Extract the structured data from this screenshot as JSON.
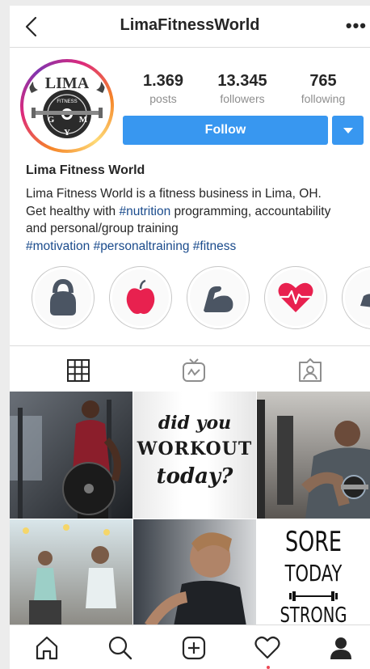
{
  "header": {
    "title": "LimaFitnessWorld",
    "more_label": "•••",
    "back_icon": "chevron-left-icon"
  },
  "profile": {
    "avatar_logo": {
      "top": "LIMA",
      "ring": "FITNESS",
      "g": "G",
      "m": "M",
      "y": "Y"
    },
    "stats": [
      {
        "value": "1.369",
        "label": "posts"
      },
      {
        "value": "13.345",
        "label": "followers"
      },
      {
        "value": "765",
        "label": "following"
      }
    ],
    "follow_label": "Follow",
    "accent": "#3897f0",
    "name": "Lima Fitness World",
    "bio": {
      "line1": "Lima Fitness World is a fitness business in Lima, OH.",
      "line2_a": "Get healthy with ",
      "line2_tag": "#nutrition",
      "line2_b": " programming, accountability",
      "line3": "and personal/group training",
      "tags": "#motivation #personaltraining #fitness"
    }
  },
  "highlights": [
    {
      "icon": "kettlebell-icon"
    },
    {
      "icon": "apple-icon"
    },
    {
      "icon": "flexed-bicep-icon"
    },
    {
      "icon": "heart-rate-icon"
    },
    {
      "icon": "partial-highlight-icon"
    }
  ],
  "tabs": [
    {
      "icon": "grid-icon"
    },
    {
      "icon": "igtv-icon"
    },
    {
      "icon": "tagged-icon"
    }
  ],
  "posts": [
    {
      "kind": "photo",
      "subject": "man with barbell plate"
    },
    {
      "kind": "quote",
      "line1": "did you",
      "line2": "WORKOUT",
      "line3": "today?"
    },
    {
      "kind": "photo",
      "subject": "man lifting dumbbell"
    },
    {
      "kind": "photo",
      "subject": "group fitness class"
    },
    {
      "kind": "photo",
      "subject": "woman on bike"
    },
    {
      "kind": "quote",
      "line1": "SORE",
      "line2": "TODAY",
      "line3": "STRONG"
    }
  ],
  "bottom_nav": [
    {
      "icon": "home-icon"
    },
    {
      "icon": "search-icon"
    },
    {
      "icon": "add-post-icon"
    },
    {
      "icon": "heart-icon"
    },
    {
      "icon": "profile-icon"
    }
  ]
}
